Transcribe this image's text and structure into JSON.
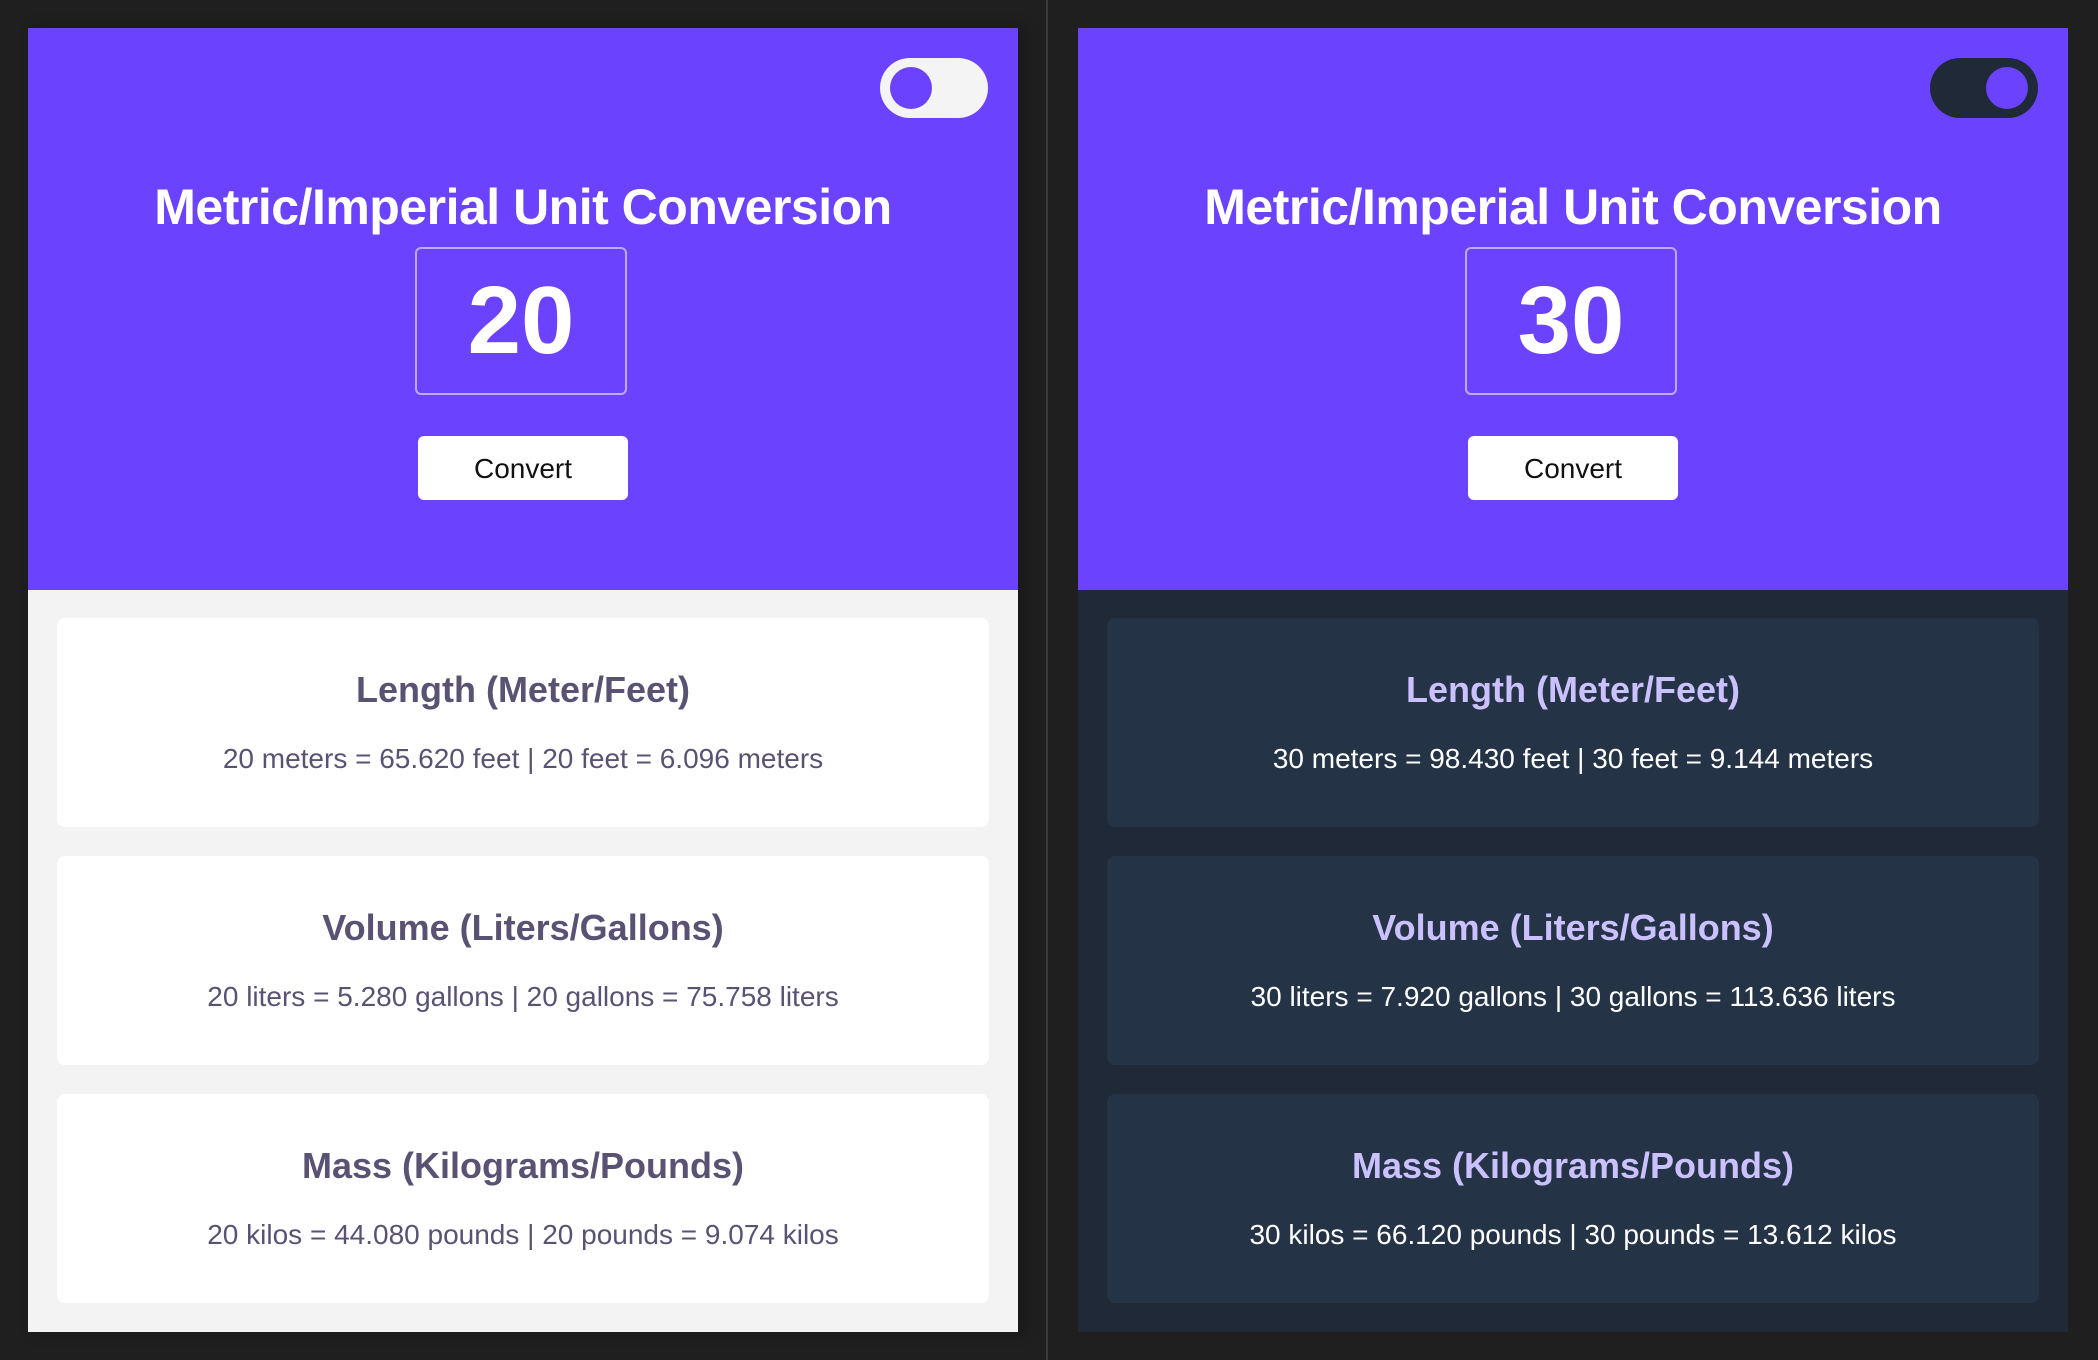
{
  "colors": {
    "accent": "#6b43ff",
    "light_card_text": "#5a5273",
    "dark_background": "#1f2937",
    "dark_card_background": "#253347",
    "dark_card_title": "#ccc1ff"
  },
  "light": {
    "theme": "light",
    "toggle_state": "off",
    "title": "Metric/Imperial Unit Conversion",
    "input_value": "20",
    "convert_label": "Convert",
    "cards": [
      {
        "title": "Length (Meter/Feet)",
        "text": "20 meters = 65.620 feet | 20 feet = 6.096 meters"
      },
      {
        "title": "Volume (Liters/Gallons)",
        "text": "20 liters = 5.280 gallons | 20 gallons = 75.758 liters"
      },
      {
        "title": "Mass (Kilograms/Pounds)",
        "text": "20 kilos = 44.080 pounds | 20 pounds = 9.074 kilos"
      }
    ]
  },
  "dark": {
    "theme": "dark",
    "toggle_state": "on",
    "title": "Metric/Imperial Unit Conversion",
    "input_value": "30",
    "convert_label": "Convert",
    "cards": [
      {
        "title": "Length (Meter/Feet)",
        "text": "30 meters = 98.430 feet | 30 feet = 9.144 meters"
      },
      {
        "title": "Volume (Liters/Gallons)",
        "text": "30 liters = 7.920 gallons | 30 gallons = 113.636 liters"
      },
      {
        "title": "Mass (Kilograms/Pounds)",
        "text": "30 kilos = 66.120 pounds | 30 pounds = 13.612 kilos"
      }
    ]
  }
}
